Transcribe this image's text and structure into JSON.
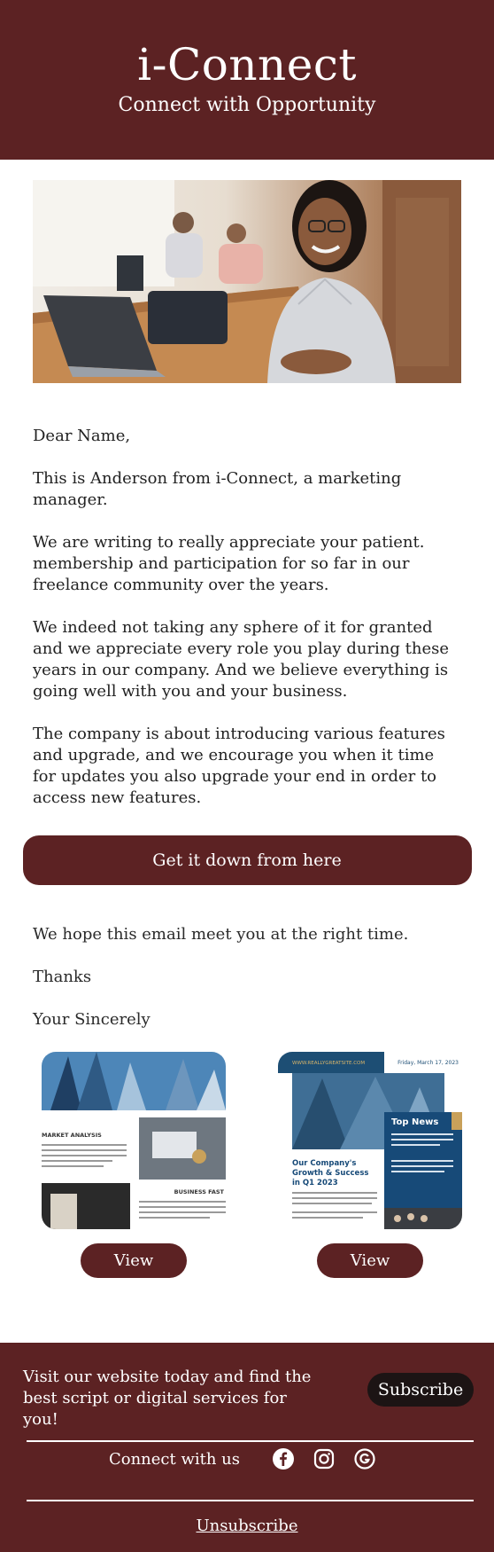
{
  "header": {
    "title": "i-Connect",
    "tagline": "Connect with Opportunity"
  },
  "hero": {
    "image": "woman-smiling-office-photo"
  },
  "letter": {
    "greeting": "Dear Name,",
    "paragraphs": [
      "This is Anderson from i-Connect, a marketing manager.",
      "We are writing to really appreciate your patient. membership and participation for so far in our freelance community over the years.",
      "We indeed not taking any sphere of it for granted and we appreciate every role you play during these years in our company. And we believe everything is going well with you and your business.",
      "The company is about introducing various features and upgrade, and we encourage you when it time for updates you also upgrade your end in order to access new features."
    ]
  },
  "cta": {
    "label": "Get it down from here"
  },
  "closing": {
    "lines": [
      "We hope this email meet you at the right time.",
      "Thanks",
      "Your Sincerely"
    ]
  },
  "cards": [
    {
      "heading_left": "MARKET ANALYSIS",
      "heading_right": "BUSINESS FAST",
      "view_label": "View"
    },
    {
      "site": "WWW.REALLYGREATSITE.COM",
      "date": "Friday, March 17, 2023",
      "side_title": "Top News",
      "headline": "Our Company's Growth & Success in Q1 2023",
      "view_label": "View"
    }
  ],
  "footer": {
    "promo": "Visit our website today and find the best script or digital services for you!",
    "subscribe_label": "Subscribe",
    "connect_label": "Connect with us",
    "social_icons": [
      "facebook-icon",
      "instagram-icon",
      "google-icon"
    ],
    "unsubscribe_label": "Unsubscribe"
  },
  "colors": {
    "brand": "#5c2223",
    "subscribe_bg": "#1c1414",
    "text": "#222222"
  }
}
